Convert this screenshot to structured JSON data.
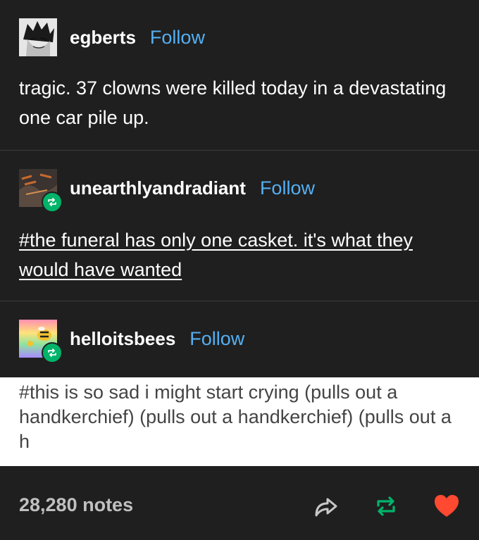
{
  "posts": [
    {
      "username": "egberts",
      "follow_label": "Follow",
      "text": "tragic. 37 clowns were killed today in a devastating one car pile up."
    },
    {
      "username": "unearthlyandradiant",
      "follow_label": "Follow",
      "text": "#the funeral has only one casket. it's what they would have wanted"
    },
    {
      "username": "helloitsbees",
      "follow_label": "Follow",
      "text": "#this is so sad i might start crying (pulls out a handkerchief) (pulls out a handkerchief) (pulls out a h"
    }
  ],
  "footer": {
    "notes": "28,280 notes",
    "share_icon": "share-arrow-icon",
    "reblog_icon": "reblog-icon",
    "like_icon": "heart-icon"
  },
  "colors": {
    "background": "#1f1f1f",
    "follow": "#55aff2",
    "reblog": "#00b46a",
    "like": "#ff4930"
  }
}
